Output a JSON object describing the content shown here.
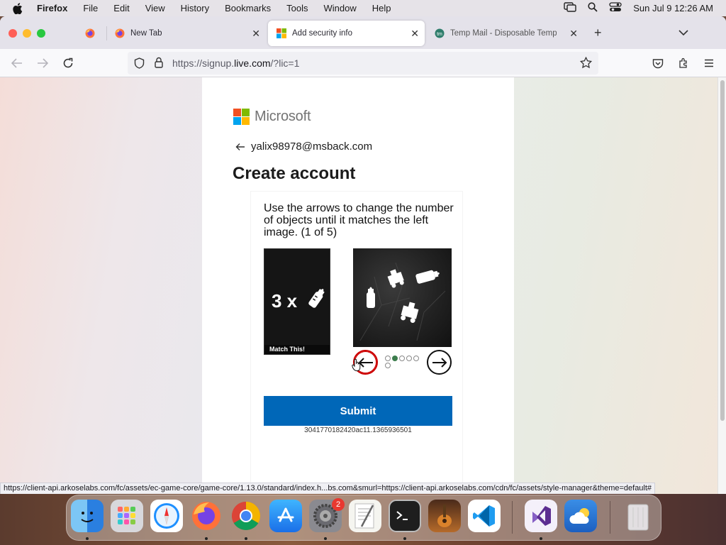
{
  "menubar": {
    "app_name": "Firefox",
    "items": [
      "File",
      "Edit",
      "View",
      "History",
      "Bookmarks",
      "Tools",
      "Window",
      "Help"
    ],
    "datetime": "Sun Jul 9  12:26 AM"
  },
  "tabs": [
    {
      "title": "",
      "icon": "firefox-icon"
    },
    {
      "title": "New Tab",
      "icon": "firefox-icon"
    },
    {
      "title": "Add security info",
      "icon": "microsoft-icon",
      "active": true
    },
    {
      "title": "Temp Mail - Disposable Tempor",
      "icon": "tempmail-icon"
    }
  ],
  "address_bar": {
    "url_prefix": "https://signup.",
    "url_domain": "live.com",
    "url_suffix": "/?lic=1"
  },
  "page": {
    "brand": "Microsoft",
    "identity": "yalix98978@msback.com",
    "heading": "Create account",
    "instructions": "Use the arrows to change the number of objects until it matches the left image. (1 of 5)",
    "reference_count": "3 x",
    "match_label": "Match This!",
    "submit_label": "Submit",
    "session_id": "3041770182420ac11.1365936501",
    "carousel_dots": 6,
    "carousel_active": 1
  },
  "status_bar": {
    "url": "https://client-api.arkoselabs.com/fc/assets/ec-game-core/game-core/1.13.0/standard/index.h...bs.com&smurl=https://client-api.arkoselabs.com/cdn/fc/assets/style-manager&theme=default#"
  },
  "dock": {
    "apps": [
      "finder",
      "launchpad",
      "safari",
      "firefox",
      "chrome",
      "app-store",
      "system-settings",
      "textedit",
      "terminal",
      "instruments",
      "vscode",
      "visual-studio",
      "weather",
      "trash"
    ],
    "system_settings_badge": "2"
  },
  "colors": {
    "ms_red": "#f25022",
    "ms_green": "#7fba00",
    "ms_blue": "#00a4ef",
    "ms_yellow": "#ffb900",
    "submit_blue": "#0067b8"
  }
}
